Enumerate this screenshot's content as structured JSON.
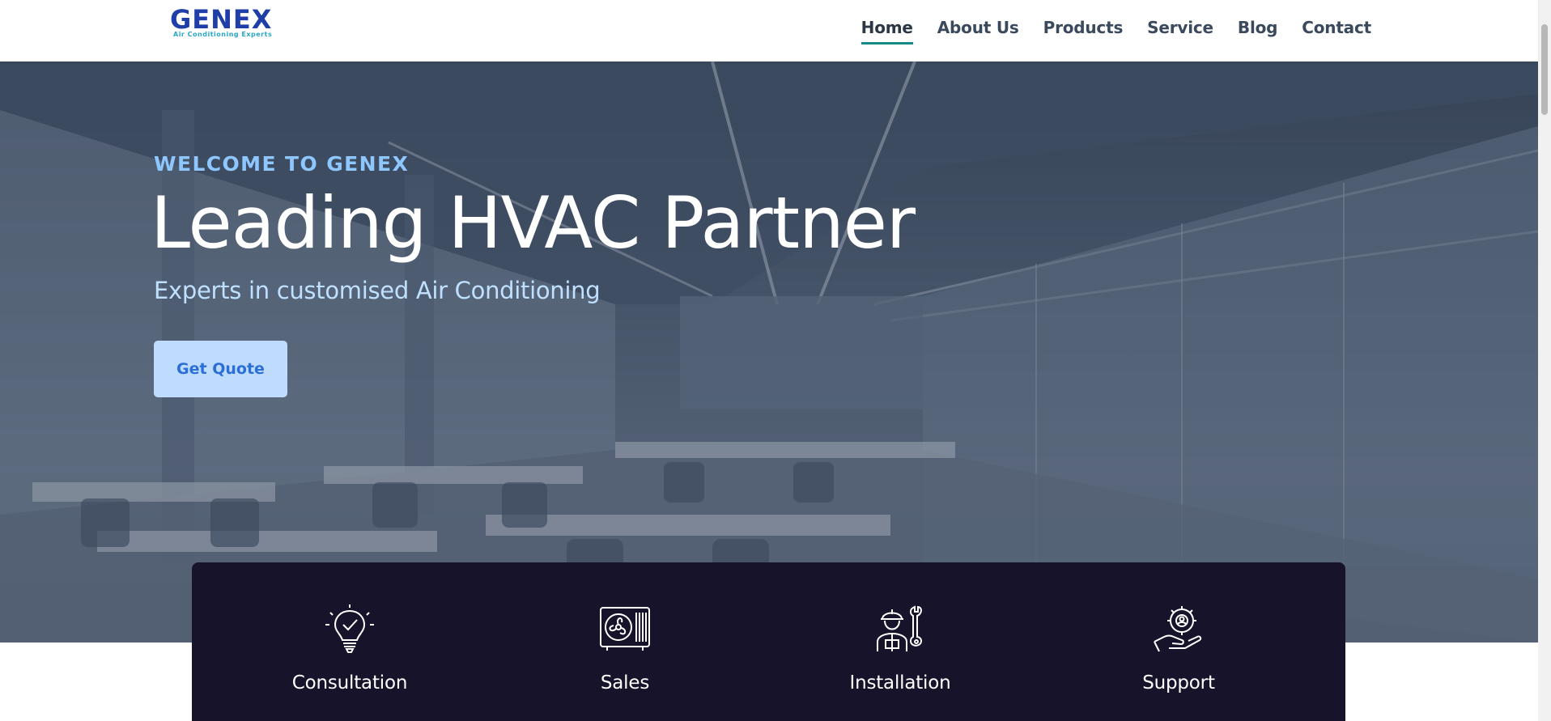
{
  "logo": {
    "wordmark": "GENEX",
    "tagline": "Air Conditioning Experts"
  },
  "nav": {
    "items": [
      {
        "label": "Home",
        "active": true
      },
      {
        "label": "About Us"
      },
      {
        "label": "Products"
      },
      {
        "label": "Service"
      },
      {
        "label": "Blog"
      },
      {
        "label": "Contact"
      }
    ]
  },
  "hero": {
    "eyebrow": "WELCOME TO GENEX",
    "headline": "Leading HVAC Partner",
    "subheadline": "Experts in customised Air Conditioning",
    "cta_label": "Get Quote"
  },
  "services": {
    "items": [
      {
        "label": "Consultation",
        "icon": "lightbulb-check-icon"
      },
      {
        "label": "Sales",
        "icon": "ac-unit-icon"
      },
      {
        "label": "Installation",
        "icon": "technician-wrench-icon"
      },
      {
        "label": "Support",
        "icon": "gear-hand-support-icon"
      }
    ]
  },
  "colors": {
    "brand_blue": "#1f3ea8",
    "accent_teal": "#1a8a86",
    "eyebrow_blue": "#8ec6ff",
    "cta_bg": "#bfdcff",
    "services_bg": "#17132b"
  }
}
